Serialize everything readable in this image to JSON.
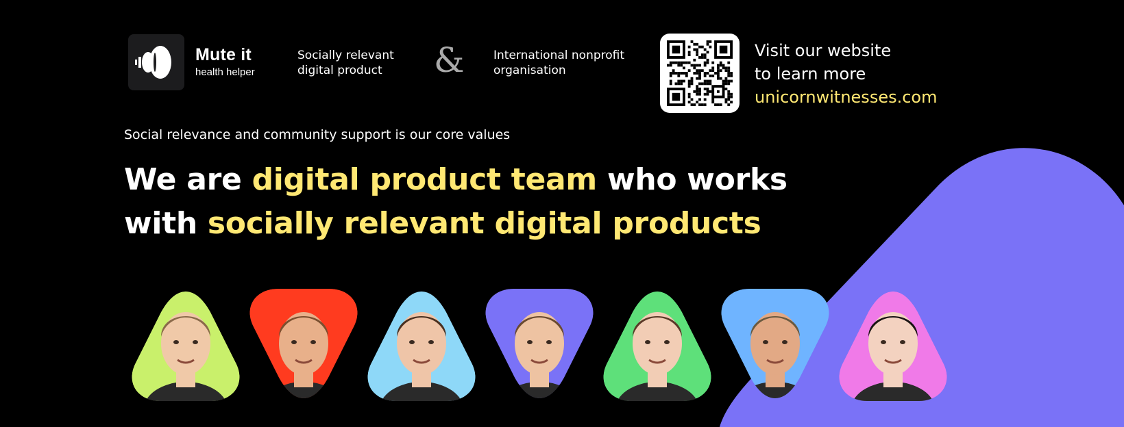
{
  "colors": {
    "background": "#000000",
    "accent_yellow": "#ffe873",
    "blob_purple": "#7a72f7",
    "logo_bg": "#1c1c1e"
  },
  "brand": {
    "name": "Mute it",
    "subtitle": "health helper",
    "logo_icon": "sound-wave-logo-icon"
  },
  "header": {
    "product_line1": "Socially relevant",
    "product_line2": "digital product",
    "ampersand": "&",
    "org_line1": "International nonprofit",
    "org_line2": "organisation",
    "visit_line1": "Visit our website",
    "visit_line2": "to learn more",
    "website": "unicornwitnesses.com",
    "qr_icon": "qr-code-icon"
  },
  "tagline": "Social relevance and community support is our core values",
  "headline": {
    "p1": "We are ",
    "h1": "digital product team",
    "p2": " who works",
    "p3": "with ",
    "h2": "socially relevant digital products"
  },
  "team": [
    {
      "name": "team-member-1",
      "color": "#c9f06b",
      "shape": "triangle",
      "skin": "#f0c9a8",
      "hair": "#8a6a4a"
    },
    {
      "name": "team-member-2",
      "color": "#ff3b1f",
      "shape": "triangle-down",
      "skin": "#e8b08a",
      "hair": "#7a5030"
    },
    {
      "name": "team-member-3",
      "color": "#8ed8f8",
      "shape": "triangle",
      "skin": "#efc5a8",
      "hair": "#4a3020"
    },
    {
      "name": "team-member-4",
      "color": "#7a72f7",
      "shape": "triangle-down",
      "skin": "#eec3a2",
      "hair": "#6a4a30"
    },
    {
      "name": "team-member-5",
      "color": "#5ee07a",
      "shape": "triangle",
      "skin": "#f2cdb5",
      "hair": "#5a3a28"
    },
    {
      "name": "team-member-6",
      "color": "#6fb4ff",
      "shape": "triangle-down",
      "skin": "#e2a985",
      "hair": "#6a5a40"
    },
    {
      "name": "team-member-7",
      "color": "#f07ae8",
      "shape": "triangle",
      "skin": "#f3d2c0",
      "hair": "#1a1414"
    }
  ]
}
